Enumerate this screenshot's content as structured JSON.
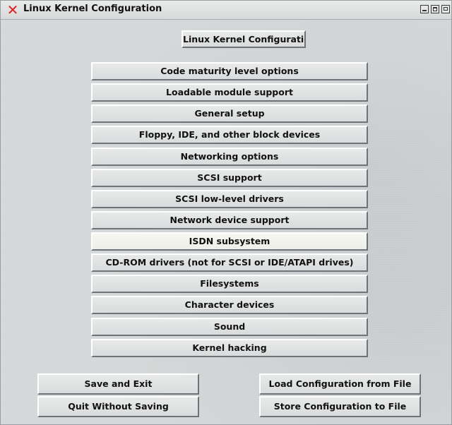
{
  "window": {
    "title": "Linux Kernel Configuration",
    "close_glyph": "✕"
  },
  "header": {
    "label": "Linux Kernel Configuration"
  },
  "menu": {
    "items": [
      {
        "label": "Code maturity level options"
      },
      {
        "label": "Loadable module support"
      },
      {
        "label": "General setup"
      },
      {
        "label": "Floppy, IDE, and other block devices"
      },
      {
        "label": "Networking options"
      },
      {
        "label": "SCSI support"
      },
      {
        "label": "SCSI low-level drivers"
      },
      {
        "label": "Network device support"
      },
      {
        "label": "ISDN subsystem"
      },
      {
        "label": "CD-ROM drivers (not for SCSI or IDE/ATAPI drives)"
      },
      {
        "label": "Filesystems"
      },
      {
        "label": "Character devices"
      },
      {
        "label": "Sound"
      },
      {
        "label": "Kernel hacking"
      }
    ]
  },
  "actions": {
    "save_exit": "Save and Exit",
    "quit": "Quit Without Saving",
    "load": "Load Configuration from File",
    "store": "Store Configuration to File"
  },
  "colors": {
    "close_icon": "#e02020",
    "window_bg": "#d5d8d8"
  }
}
